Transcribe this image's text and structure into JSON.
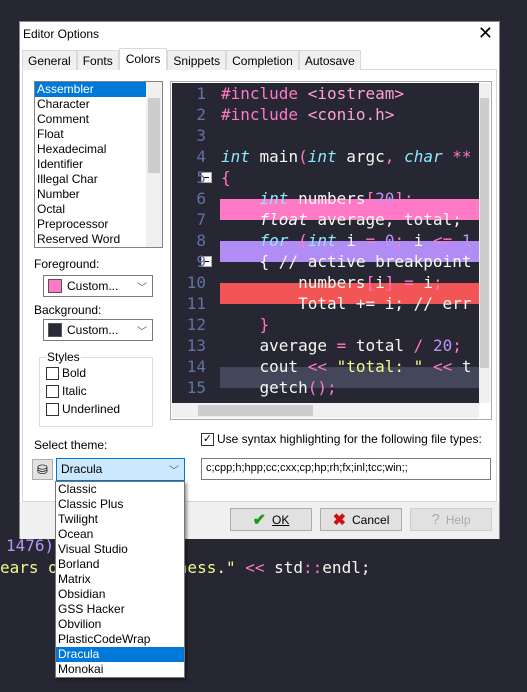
{
  "background_code": {
    "line1": "1476)",
    "line2_a": "ears o",
    "line2_b": "ness.\" ",
    "line2_op": "<<",
    "line2_c": " std",
    "line2_sep": "::",
    "line2_d": "endl;"
  },
  "dialog": {
    "title": "Editor Options",
    "close": "✕",
    "tabs": [
      "General",
      "Fonts",
      "Colors",
      "Snippets",
      "Completion",
      "Autosave"
    ],
    "active_tab": "Colors",
    "elements": [
      "Assembler",
      "Character",
      "Comment",
      "Float",
      "Hexadecimal",
      "Identifier",
      "Illegal Char",
      "Number",
      "Octal",
      "Preprocessor",
      "Reserved Word"
    ],
    "selected_element": "Assembler",
    "foreground": {
      "label": "Foreground:",
      "value": "Custom...",
      "color": "#ff79c6"
    },
    "background": {
      "label": "Background:",
      "value": "Custom...",
      "color": "#282a36"
    },
    "styles": {
      "label": "Styles",
      "bold": "Bold",
      "italic": "Italic",
      "underlined": "Underlined"
    },
    "preview": {
      "line_numbers": [
        "1",
        "2",
        "3",
        "4",
        "5",
        "6",
        "7",
        "8",
        "9",
        "10",
        "11",
        "12",
        "13",
        "14",
        "15"
      ]
    },
    "syntax_checkbox": {
      "label": "Use syntax highlighting for the following file types:",
      "checked": true
    },
    "file_types": "c;cpp;h;hpp;cc;cxx;cp;hp;rh;fx;inl;tcc;win;;",
    "theme": {
      "label": "Select theme:",
      "value": "Dracula",
      "options": [
        "Classic",
        "Classic Plus",
        "Twilight",
        "Ocean",
        "Visual Studio",
        "Borland",
        "Matrix",
        "Obsidian",
        "GSS Hacker",
        "Obvilion",
        "PlasticCodeWrap",
        "Dracula",
        "Monokai"
      ]
    },
    "buttons": {
      "ok": "OK",
      "cancel": "Cancel",
      "help": "Help"
    },
    "colors": {
      "breakpoint": "#ff79c6",
      "active_breakpoint": "#b18cf5",
      "error": "#f25555",
      "current_line": "#44475a",
      "selection": "#0078d7"
    }
  }
}
